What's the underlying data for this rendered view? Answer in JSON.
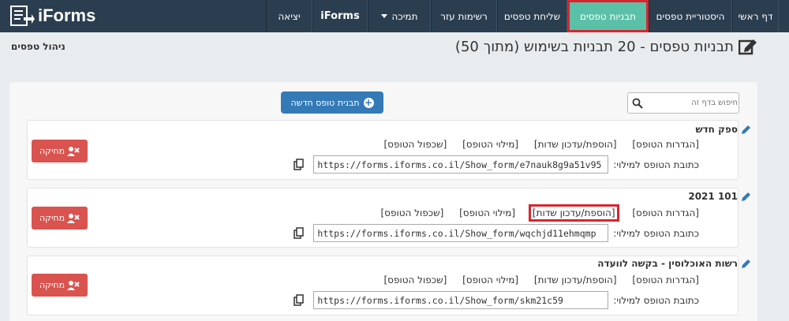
{
  "brand": {
    "name": "iForms"
  },
  "nav": [
    {
      "label": "דף ראשי",
      "active": false
    },
    {
      "label": "היסטוריית טפסים",
      "active": false
    },
    {
      "label": "תבניות טפסים",
      "active": true
    },
    {
      "label": "שליחת טפסים",
      "active": false
    },
    {
      "label": "רשימות עזר",
      "active": false
    },
    {
      "label": "תמיכה",
      "active": false
    },
    {
      "label": "iForms",
      "active": false
    },
    {
      "label": "יציאה",
      "active": false
    }
  ],
  "header": {
    "title": "תבניות טפסים - 20 תבניות בשימוש (מתוך 50)",
    "manage": "ניהול טפסים"
  },
  "search": {
    "placeholder": "חיפוש בדף זה"
  },
  "new_template": {
    "label": "תבנית טופס חדשה"
  },
  "link_labels": {
    "settings": "[הגדרות הטופס]",
    "fields": "[הוספת/עדכון שדות]",
    "fill": "[מילוי הטופס]",
    "duplicate": "[שכפול הטופס]",
    "url_label": "כתובת הטופס למילוי:",
    "delete": "מחיקה"
  },
  "forms": [
    {
      "title": "ספק חדש",
      "url": "https://forms.iforms.co.il/Show_form/e7nauk8g9a51v95"
    },
    {
      "title": "101 2021",
      "url": "https://forms.iforms.co.il/Show_form/wqchjd11ehmqmp"
    },
    {
      "title": "רשות האוכלוסין - בקשה לוועדה",
      "url": "https://forms.iforms.co.il/Show_form/skm21c59"
    }
  ],
  "colors": {
    "navbar": "#2b3e50",
    "active": "#5bc0a8",
    "primary": "#337ab7",
    "danger": "#d9534f",
    "highlight": "#d9262e"
  }
}
